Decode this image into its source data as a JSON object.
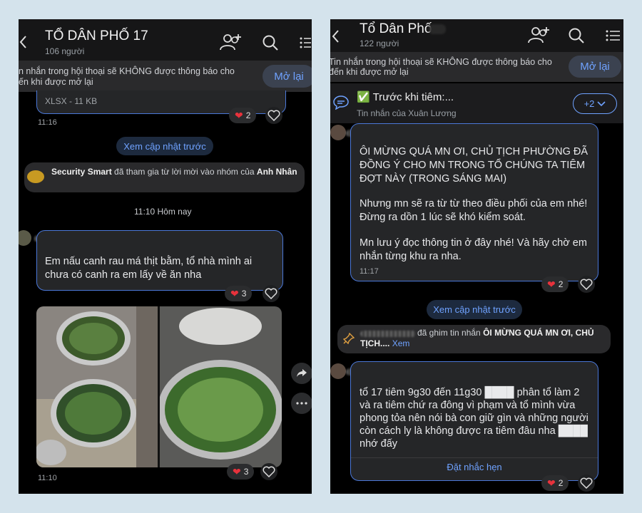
{
  "left": {
    "title": "TỔ DÂN PHỐ 17",
    "members": "106 người",
    "banner_line1": "n nhắn trong hội thoại sẽ KHÔNG được thông báo cho",
    "banner_line2": "ến khi được mở lại",
    "reopen_label": "Mở lại",
    "file_info": "XLSX - 11 KB",
    "file_reaction_count": "2",
    "file_time": "11:16",
    "see_earlier": "Xem cập nhật trước",
    "join_actor": "Security Smart",
    "join_text": " đã tham gia từ lời mời vào nhóm của ",
    "join_inviter": "Anh Nhân",
    "date_sep": "11:10 Hôm nay",
    "message_text": "Em nấu canh rau má thịt bằm, tổ nhà mình ai chưa có canh ra em lấy về ăn nha",
    "message_reaction_count": "3",
    "photo_reaction_count": "3",
    "photo_time": "11:10"
  },
  "right": {
    "title": "Tổ Dân Phố",
    "members": "122 người",
    "banner_line1": "Tin nhắn trong hội thoại sẽ KHÔNG được thông báo cho",
    "banner_line2": "đến khi được mở lại",
    "reopen_label": "Mở lại",
    "pinned_text": "✅ Trước khi tiêm:...",
    "pinned_from": "Tin nhắn của Xuân Lương",
    "pinned_more": "+2",
    "msg1_para1": "ÔI MỪNG QUÁ MN ƠI, CHỦ TỊCH PHƯỜNG ĐÃ ĐỒNG Ý CHO MN TRONG TỔ CHÚNG TA TIÊM ĐỢT NÀY (TRONG SÁNG MAI)",
    "msg1_para2": "Nhưng mn sẽ ra từ từ theo điều phối của em nhé! Đừng ra dồn 1 lúc sẽ khó kiểm soát.",
    "msg1_para3": "Mn lưu ý đọc thông tin ở đây nhé! Và hãy chờ em nhắn từng khu ra nha.",
    "msg1_time": "11:17",
    "msg1_reaction_count": "2",
    "see_earlier": "Xem cập nhật trước",
    "pin_notice": "đã ghim tin nhắn ",
    "pin_notice_bold": "ÔI MỪNG QUÁ MN ƠI, CHỦ TỊCH....",
    "pin_notice_link": "Xem",
    "msg2_text": "tổ 17 tiêm 9g30 đến 11g30 ████ phân tổ làm 2 và ra tiêm chứ ra đông vì phạm và tổ mình vừa phong tỏa nên nói bà con giữ gìn và những người còn cách ly là không được ra tiêm đâu nha ████ nhớ đấy",
    "reminder_label": "Đặt nhắc hẹn",
    "msg2_reaction_count": "2"
  },
  "colors": {
    "accent": "#6fa2ff",
    "bubble_border": "#4b78d8",
    "heart": "#e8323c"
  }
}
